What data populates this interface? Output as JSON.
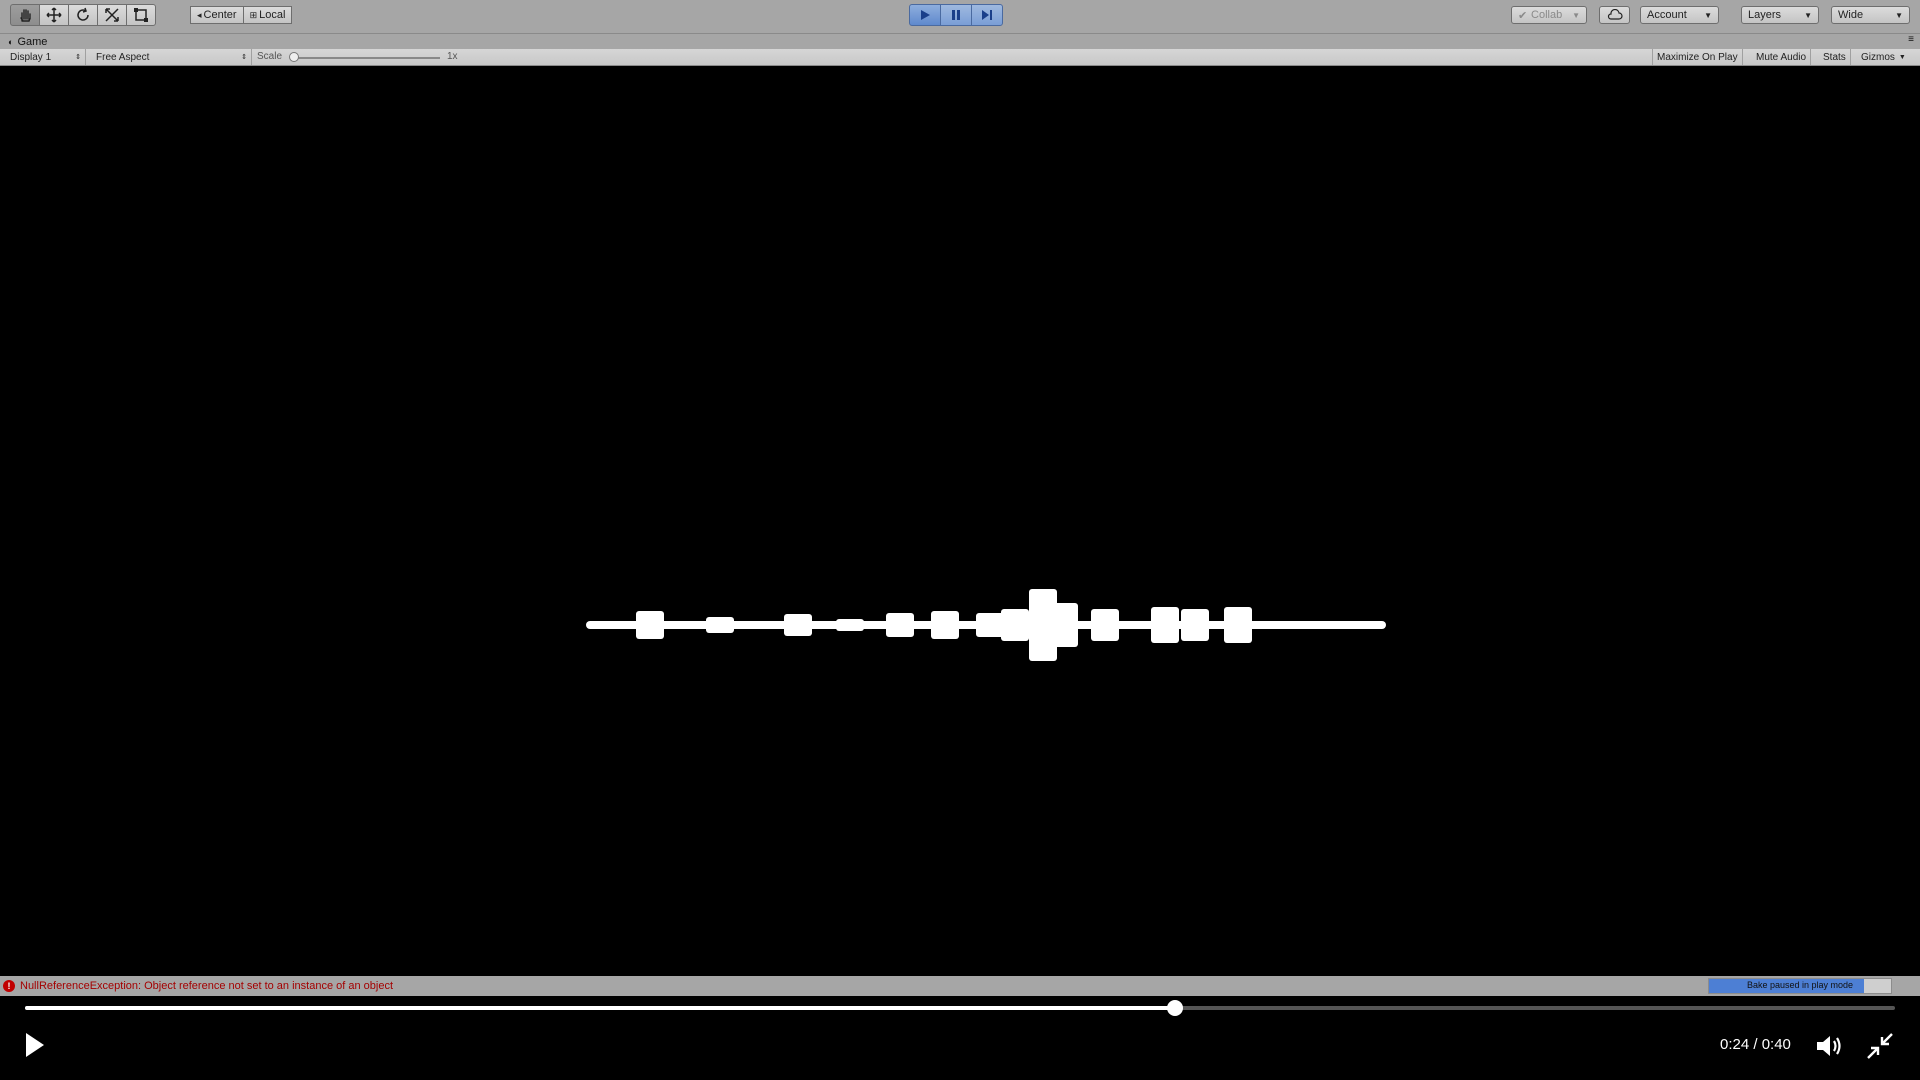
{
  "toolbar": {
    "tools": [
      "hand-tool",
      "move-tool",
      "rotate-tool",
      "scale-tool",
      "rect-tool"
    ],
    "pivot_center": "Center",
    "pivot_local": "Local",
    "collab": "Collab",
    "account": "Account",
    "layers": "Layers",
    "layout": "Wide"
  },
  "game": {
    "tab_label": "Game",
    "display": "Display 1",
    "aspect": "Free Aspect",
    "scale_label": "Scale",
    "scale_value": "1x",
    "maximize": "Maximize On Play",
    "mute": "Mute Audio",
    "stats": "Stats",
    "gizmos": "Gizmos"
  },
  "status": {
    "error_message": "NullReferenceException: Object reference not set to an instance of an object",
    "bake_label": "Bake paused in play mode",
    "bake_progress": 0.85
  },
  "player": {
    "current_time": "0:24",
    "duration": "0:40",
    "time_display": "0:24 / 0:40",
    "progress": 0.615
  },
  "colors": {
    "toolbar_bg": "#a6a6a6",
    "play_accent": "#5f89cd",
    "error": "#c10000",
    "waveform": "#ffffff"
  }
}
